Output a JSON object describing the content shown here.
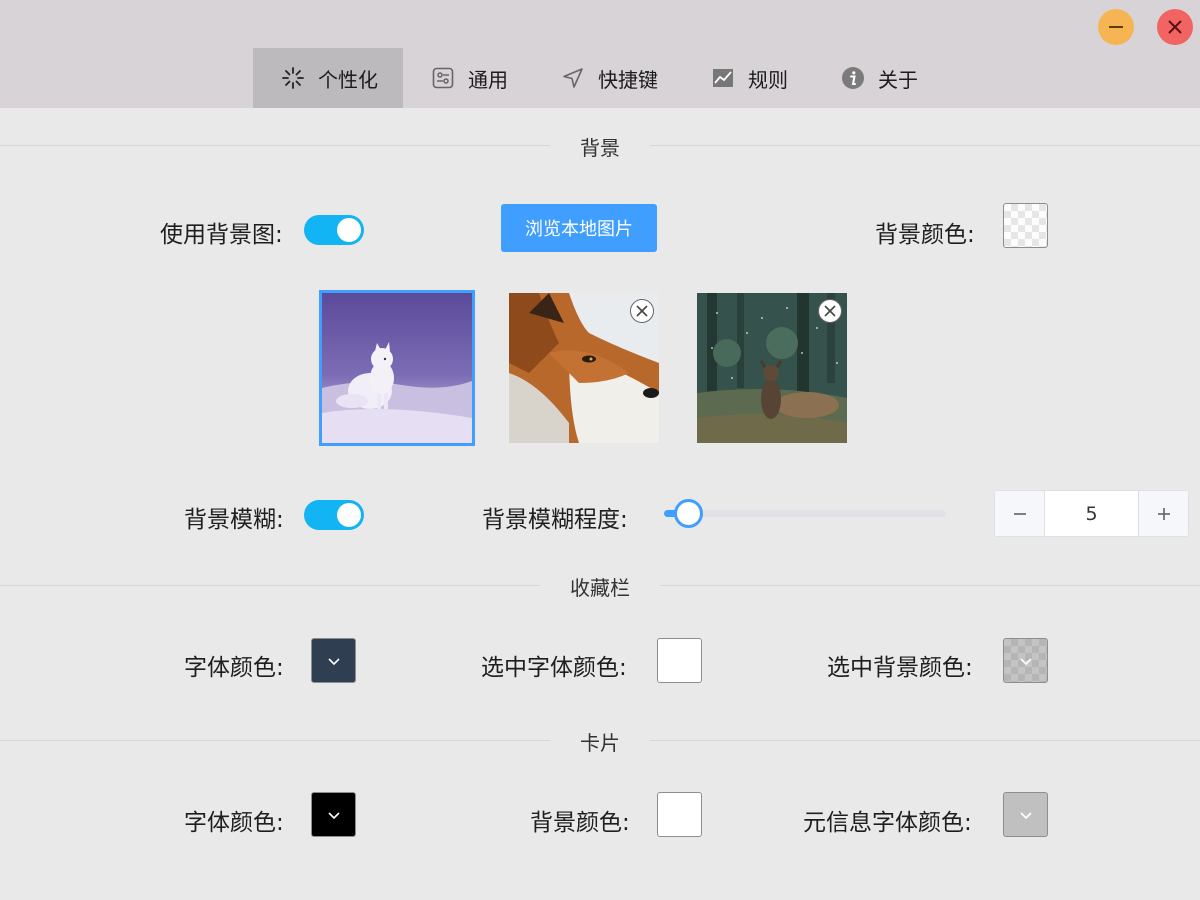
{
  "tabs": [
    {
      "label": "个性化",
      "icon": "sparkle-icon",
      "active": true
    },
    {
      "label": "通用",
      "icon": "sliders-icon",
      "active": false
    },
    {
      "label": "快捷键",
      "icon": "navigation-icon",
      "active": false
    },
    {
      "label": "规则",
      "icon": "chart-icon",
      "active": false
    },
    {
      "label": "关于",
      "icon": "info-icon",
      "active": false
    }
  ],
  "window": {
    "minimize_icon": "minimize-icon",
    "close_icon": "close-icon",
    "minimize_color": "#f6b552",
    "close_color": "#f16462"
  },
  "background": {
    "section_title": "背景",
    "use_image_label": "使用背景图:",
    "use_image_enabled": true,
    "browse_label": "浏览本地图片",
    "color_label": "背景颜色:",
    "thumbnails": [
      {
        "subject": "arctic fox in snow",
        "selected": true,
        "removable": false
      },
      {
        "subject": "red fox close-up",
        "selected": false,
        "removable": true
      },
      {
        "subject": "deer in snowy forest",
        "selected": false,
        "removable": true
      }
    ],
    "blur_label": "背景模糊:",
    "blur_enabled": true,
    "blur_level_label": "背景模糊程度:",
    "blur_level": 5,
    "blur_value": "5"
  },
  "favorites": {
    "section_title": "收藏栏",
    "font_color_label": "字体颜色:",
    "font_color": "#2f3e50",
    "selected_font_color_label": "选中字体颜色:",
    "selected_font_color": "#ffffff",
    "selected_bg_color_label": "选中背景颜色:"
  },
  "card": {
    "section_title": "卡片",
    "font_color_label": "字体颜色:",
    "font_color": "#000000",
    "bg_color_label": "背景颜色:",
    "bg_color": "#ffffff",
    "meta_font_color_label": "元信息字体颜色:",
    "meta_font_color": "#c0c0c0"
  },
  "accent": "#409eff",
  "switch_color": "#13b4f4"
}
